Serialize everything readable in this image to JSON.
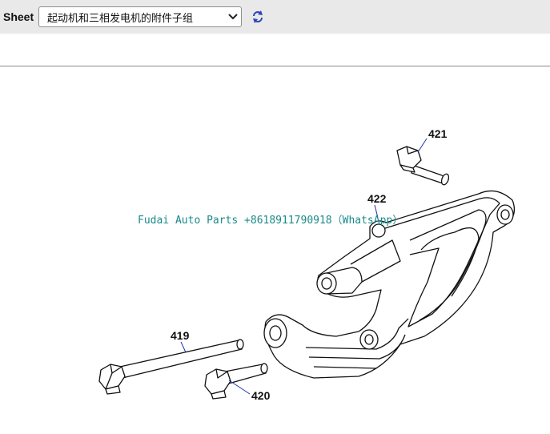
{
  "toolbar": {
    "sheet_label": "Sheet",
    "sheet_select": {
      "selected": "起动机和三相发电机的附件子组",
      "options": [
        "起动机和三相发电机的附件子组"
      ]
    },
    "refresh_icon": "refresh-icon"
  },
  "diagram": {
    "callouts": [
      {
        "id": "421",
        "label": "421"
      },
      {
        "id": "422",
        "label": "422"
      },
      {
        "id": "419",
        "label": "419"
      },
      {
        "id": "420",
        "label": "420"
      }
    ],
    "watermark": "Fudai Auto Parts +8618911790918（WhatsApp）"
  },
  "colors": {
    "toolbar_bg": "#e9e9e9",
    "leader_line": "#2233aa",
    "watermark": "#1b8a8a"
  }
}
